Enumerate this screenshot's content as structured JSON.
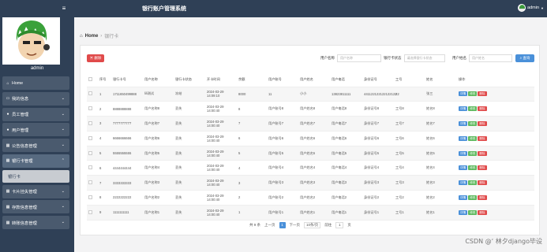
{
  "header": {
    "title": "银行账户管理系统",
    "user": "admin"
  },
  "profile": {
    "name": "admin"
  },
  "sidebar": {
    "items": [
      {
        "label": "Home",
        "icon": "home-icon"
      },
      {
        "label": "我的信息",
        "icon": "card-icon"
      },
      {
        "label": "员工管理",
        "icon": "user-icon"
      },
      {
        "label": "用户管理",
        "icon": "user-icon"
      },
      {
        "label": "公告信息管理",
        "icon": "grid-icon"
      },
      {
        "label": "银行卡管理",
        "icon": "grid-icon"
      },
      {
        "label": "卡片挂失管理",
        "icon": "grid-icon"
      },
      {
        "label": "存款信息管理",
        "icon": "grid-icon"
      },
      {
        "label": "转账信息管理",
        "icon": "grid-icon"
      }
    ],
    "sub_item": "银行卡"
  },
  "breadcrumb": {
    "home": "Home",
    "current": "银行卡"
  },
  "toolbar": {
    "delete": "删除",
    "filter1_label": "用户名称",
    "filter1_placeholder": "用户名称",
    "filter2_label": "银行卡状态",
    "filter2_placeholder": "请选择银行卡状态",
    "filter3_label": "用户姓名",
    "filter3_placeholder": "用户姓名",
    "search": "查询"
  },
  "table": {
    "headers": [
      "",
      "序号",
      "银行卡号",
      "用户名称",
      "银行卡状态",
      "开卡时间",
      "余额",
      "用户账号",
      "用户姓名",
      "用户电话",
      "身份证号",
      "工号",
      "姓名",
      "操作"
    ],
    "actions": {
      "detail": "详情",
      "edit": "修改",
      "del": "删除"
    },
    "rows": [
      {
        "no": "1",
        "card": "1711650499888",
        "uname": "lili测试",
        "status": "冻结",
        "time": "2024-03-29 14:09:10",
        "balance": "8000",
        "account": "11",
        "name": "小小",
        "phone": "13823811111",
        "idno": "441122122122122122",
        "empno": "22",
        "ename": "张三"
      },
      {
        "no": "2",
        "card": "8888888888",
        "uname": "用户名称8",
        "status": "丢失",
        "time": "2024-03-29 14:00:40",
        "balance": "8",
        "account": "用户账号8",
        "name": "用户姓名8",
        "phone": "用户电话8",
        "idno": "身份证号8",
        "empno": "工号8",
        "ename": "姓名8"
      },
      {
        "no": "3",
        "card": "7777777777",
        "uname": "用户名称7",
        "status": "丢失",
        "time": "2024-03-29 14:00:40",
        "balance": "7",
        "account": "用户账号7",
        "name": "用户姓名7",
        "phone": "用户电话7",
        "idno": "身份证号7",
        "empno": "工号7",
        "ename": "姓名7"
      },
      {
        "no": "4",
        "card": "6666666666",
        "uname": "用户名称6",
        "status": "丢失",
        "time": "2024-03-29 14:00:40",
        "balance": "6",
        "account": "用户账号6",
        "name": "用户姓名6",
        "phone": "用户电话6",
        "idno": "身份证号6",
        "empno": "工号6",
        "ename": "姓名6"
      },
      {
        "no": "5",
        "card": "5555555555",
        "uname": "用户名称5",
        "status": "丢失",
        "time": "2024-03-29 14:00:40",
        "balance": "5",
        "account": "用户账号5",
        "name": "用户姓名5",
        "phone": "用户电话5",
        "idno": "身份证号5",
        "empno": "工号5",
        "ename": "姓名5"
      },
      {
        "no": "6",
        "card": "4444444444",
        "uname": "用户名称4",
        "status": "丢失",
        "time": "2024-03-29 14:00:40",
        "balance": "4",
        "account": "用户账号4",
        "name": "用户姓名4",
        "phone": "用户电话4",
        "idno": "身份证号4",
        "empno": "工号4",
        "ename": "姓名4"
      },
      {
        "no": "7",
        "card": "3333333333",
        "uname": "用户名称3",
        "status": "丢失",
        "time": "2024-03-29 14:00:40",
        "balance": "3",
        "account": "用户账号3",
        "name": "用户姓名3",
        "phone": "用户电话3",
        "idno": "身份证号3",
        "empno": "工号3",
        "ename": "姓名3"
      },
      {
        "no": "8",
        "card": "2222222222",
        "uname": "用户名称2",
        "status": "丢失",
        "time": "2024-03-29 14:00:40",
        "balance": "2",
        "account": "用户账号2",
        "name": "用户姓名2",
        "phone": "用户电话2",
        "idno": "身份证号2",
        "empno": "工号2",
        "ename": "姓名2"
      },
      {
        "no": "9",
        "card": "1111111111",
        "uname": "用户名称1",
        "status": "丢失",
        "time": "2024-03-29 14:00:40",
        "balance": "1",
        "account": "用户账号1",
        "name": "用户姓名1",
        "phone": "用户电话1",
        "idno": "身份证号1",
        "empno": "工号1",
        "ename": "姓名1"
      }
    ]
  },
  "pager": {
    "total": "共 9 条",
    "prev": "上一页",
    "current": "1",
    "next": "下一页",
    "per_page": "10条/页",
    "goto": "前往",
    "goto_value": "1",
    "page_unit": "页"
  },
  "watermark": "CSDN @‘ 林夕django毕设"
}
